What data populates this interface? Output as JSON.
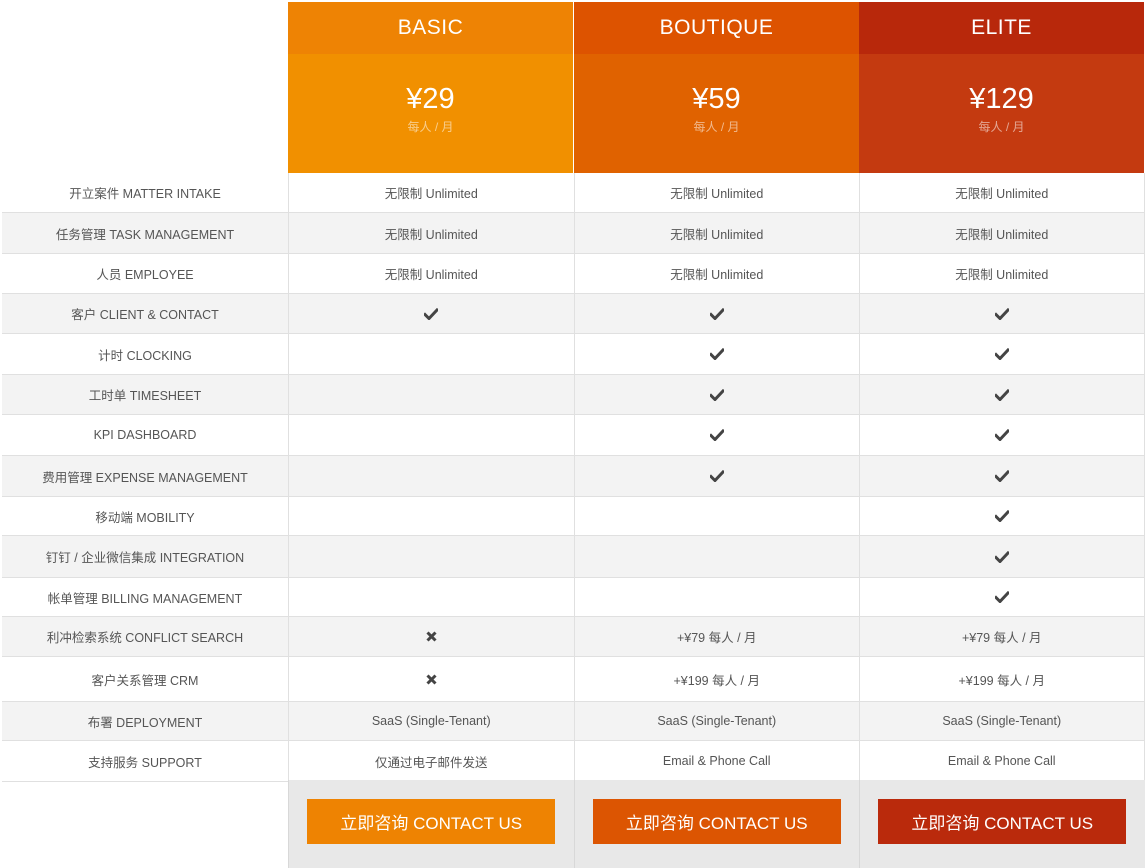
{
  "plans": [
    {
      "name": "BASIC",
      "price": "¥29",
      "unit": "每人 / 月",
      "header_color": "#EE8304",
      "price_color": "#F19000",
      "button_color": "#EE8302",
      "button_label": "立即咨询 CONTACT US"
    },
    {
      "name": "BOUTIQUE",
      "price": "¥59",
      "unit": "每人 / 月",
      "header_color": "#DD5300",
      "price_color": "#E06200",
      "button_color": "#DC5502",
      "button_label": "立即咨询 CONTACT US"
    },
    {
      "name": "ELITE",
      "price": "¥129",
      "unit": "每人 / 月",
      "header_color": "#B8280B",
      "price_color": "#C43A10",
      "button_color": "#BA2A0C",
      "button_label": "立即咨询 CONTACT US"
    }
  ],
  "features": [
    {
      "label": "开立案件 MATTER INTAKE",
      "values": [
        "无限制 Unlimited",
        "无限制 Unlimited",
        "无限制 Unlimited"
      ]
    },
    {
      "label": "任务管理 TASK MANAGEMENT",
      "values": [
        "无限制 Unlimited",
        "无限制 Unlimited",
        "无限制 Unlimited"
      ]
    },
    {
      "label": "人员 EMPLOYEE",
      "values": [
        "无限制 Unlimited",
        "无限制 Unlimited",
        "无限制 Unlimited"
      ]
    },
    {
      "label": "客户 CLIENT & CONTACT",
      "values": [
        "check",
        "check",
        "check"
      ]
    },
    {
      "label": "计时 CLOCKING",
      "values": [
        "",
        "check",
        "check"
      ]
    },
    {
      "label": "工时单 TIMESHEET",
      "values": [
        "",
        "check",
        "check"
      ]
    },
    {
      "label": "KPI DASHBOARD",
      "values": [
        "",
        "check",
        "check"
      ]
    },
    {
      "label": "费用管理 EXPENSE MANAGEMENT",
      "values": [
        "",
        "check",
        "check"
      ]
    },
    {
      "label": "移动端 MOBILITY",
      "values": [
        "",
        "",
        "check"
      ]
    },
    {
      "label": "钉钉 / 企业微信集成 INTEGRATION",
      "values": [
        "",
        "",
        "check"
      ]
    },
    {
      "label": "帐单管理 BILLING MANAGEMENT",
      "values": [
        "",
        "",
        "check"
      ]
    },
    {
      "label": "利冲检索系统 CONFLICT SEARCH",
      "values": [
        "cross",
        "+¥79 每人 / 月",
        "+¥79 每人 / 月"
      ]
    },
    {
      "label": "客户关系管理 CRM",
      "values": [
        "cross",
        "+¥199 每人 / 月",
        "+¥199 每人 / 月"
      ]
    },
    {
      "label": "布署 DEPLOYMENT",
      "values": [
        "SaaS (Single-Tenant)",
        "SaaS (Single-Tenant)",
        "SaaS (Single-Tenant)"
      ]
    },
    {
      "label": "支持服务 SUPPORT",
      "values": [
        "仅通过电子邮件发送",
        "Email & Phone Call",
        "Email & Phone Call"
      ]
    }
  ]
}
